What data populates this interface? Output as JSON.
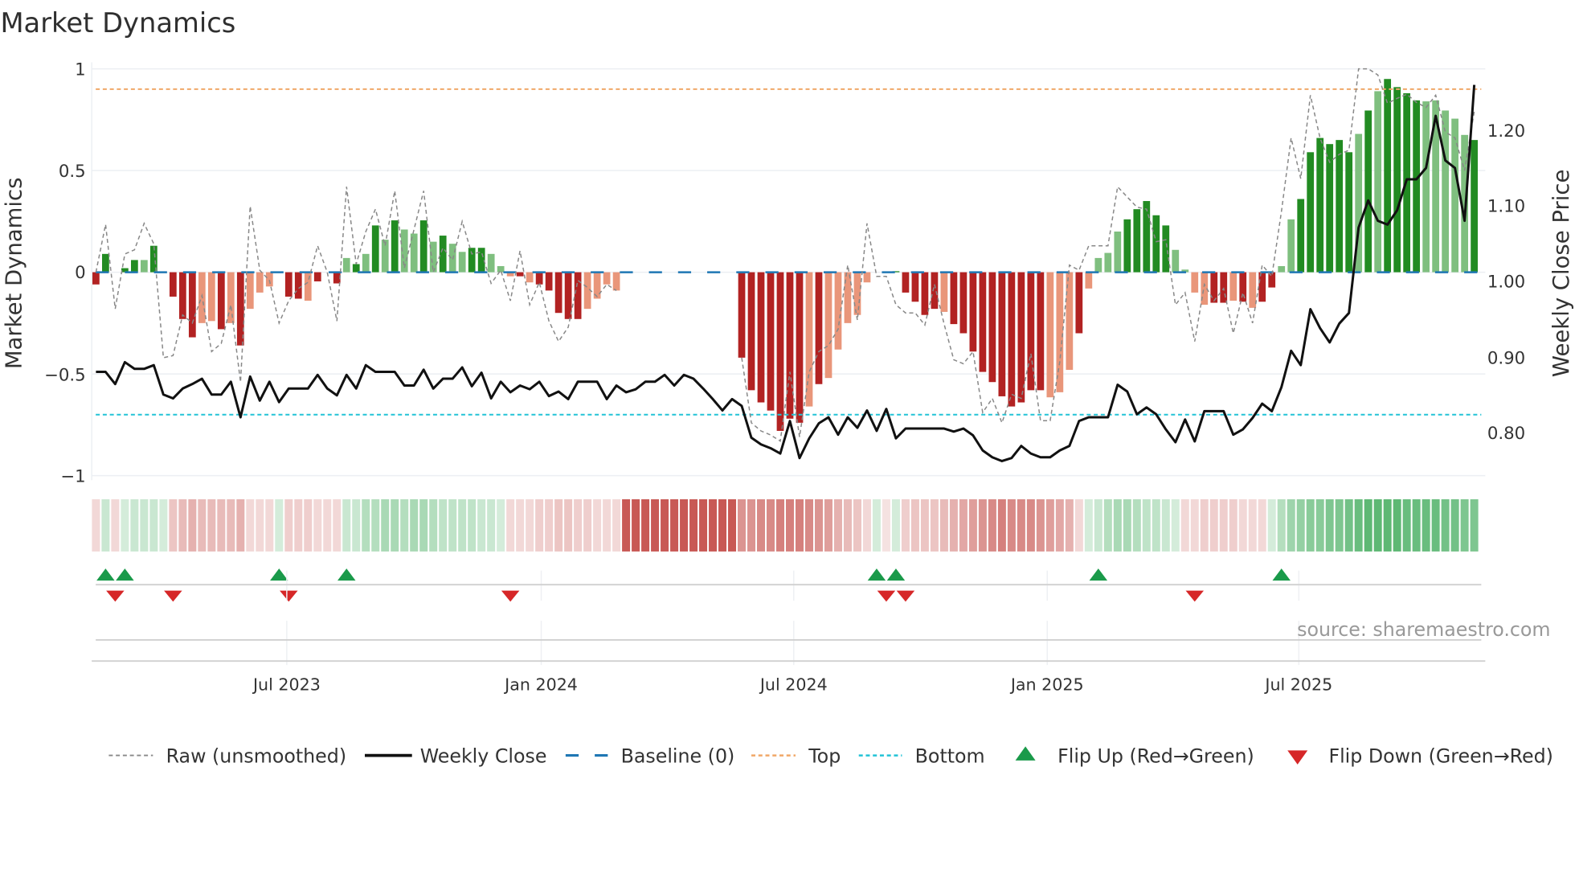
{
  "title": "Market Dynamics",
  "source": "source: sharemaestro.com",
  "colors": {
    "bar_green_strong": "#228b22",
    "bar_green_weak": "#7fbf7f",
    "bar_red_strong": "#b22222",
    "bar_red_weak": "#e9967a",
    "raw": "#888888",
    "close": "#111111",
    "baseline": "#1f77b4",
    "top": "#f0a868",
    "bottom": "#22c3d6",
    "flip_up": "#1a9a4a",
    "flip_down": "#d62728",
    "strip_green": [
      40,
      160,
      70
    ],
    "strip_red": [
      190,
      60,
      55
    ]
  },
  "chart_data": {
    "type": "bar",
    "title": "Market Dynamics",
    "ylabel": "Market Dynamics",
    "y2label": "Weekly Close Price",
    "ylim": [
      -1,
      1
    ],
    "y2lim": [
      0.7333,
      1.2666
    ],
    "yticks": [
      "1",
      "0.5",
      "0",
      "−0.5",
      "−1"
    ],
    "ytick_values": [
      1,
      0.5,
      0,
      -0.5,
      -1
    ],
    "y2ticks": [
      "1.20",
      "1.10",
      "1.00",
      "0.90",
      "0.80"
    ],
    "y2tick_values": [
      1.2,
      1.1,
      1.0,
      0.9,
      0.8
    ],
    "x_unit": "week index",
    "n_weeks": 144,
    "xticks": [
      "Jul 2023",
      "Jan 2024",
      "Jul 2024",
      "Jan 2025",
      "Jul 2025"
    ],
    "xtick_positions": [
      19.8,
      46.2,
      72.4,
      98.7,
      124.8
    ],
    "top_level": 0.9,
    "bottom_level": -0.7,
    "baseline": 0,
    "grid": true,
    "legend_position": "bottom",
    "series": [
      {
        "name": "Market Dynamics (bars)",
        "values": [
          -0.06,
          0.09,
          0,
          0.02,
          0.06,
          0.06,
          0.13,
          0,
          -0.12,
          -0.23,
          -0.32,
          -0.25,
          -0.24,
          -0.28,
          -0.25,
          -0.36,
          -0.18,
          -0.1,
          -0.07,
          0,
          -0.12,
          -0.13,
          -0.14,
          -0.045,
          0,
          -0.055,
          0.07,
          0.04,
          0.09,
          0.23,
          0.16,
          0.255,
          0.21,
          0.19,
          0.255,
          0.15,
          0.18,
          0.14,
          0.1,
          0.12,
          0.12,
          0.09,
          0.03,
          -0.02,
          -0.02,
          -0.05,
          -0.06,
          -0.09,
          -0.2,
          -0.23,
          -0.23,
          -0.18,
          -0.13,
          -0.06,
          -0.09,
          null,
          null,
          null,
          null,
          null,
          null,
          null,
          null,
          null,
          null,
          null,
          null,
          -0.42,
          -0.58,
          -0.64,
          -0.68,
          -0.78,
          -0.72,
          -0.74,
          -0.66,
          -0.55,
          -0.52,
          -0.38,
          -0.25,
          -0.21,
          -0.05,
          0,
          0,
          0.005,
          -0.1,
          -0.145,
          -0.21,
          -0.18,
          -0.195,
          -0.255,
          -0.3,
          -0.39,
          -0.49,
          -0.54,
          -0.61,
          -0.66,
          -0.64,
          -0.58,
          -0.58,
          -0.615,
          -0.59,
          -0.48,
          -0.3,
          -0.08,
          0.07,
          0.095,
          0.2,
          0.26,
          0.31,
          0.35,
          0.28,
          0.23,
          0.11,
          0.013,
          -0.1,
          -0.16,
          -0.15,
          -0.15,
          -0.14,
          -0.145,
          -0.175,
          -0.145,
          -0.075,
          0.03,
          0.26,
          0.36,
          0.59,
          0.66,
          0.63,
          0.65,
          0.59,
          0.68,
          0.795,
          0.89,
          0.95,
          0.91,
          0.88,
          0.845,
          0.84,
          0.845,
          0.795,
          0.755,
          0.675,
          0.65
        ],
        "strength": "dddddldddddlldldllldddldddldldldlldldllddllldldddddlllldddddddddddddddddddldllllllddddddlddddddddddllldlllldddddllllddldlddllddddddldlddddllllldllll"
      },
      {
        "name": "Raw (unsmoothed)",
        "values": [
          0.0,
          0.235,
          -0.18,
          0.09,
          0.11,
          0.24,
          0.14,
          -0.42,
          -0.41,
          -0.21,
          -0.25,
          -0.115,
          -0.39,
          -0.35,
          -0.16,
          -0.54,
          0.325,
          0.01,
          -0.04,
          -0.25,
          -0.14,
          -0.08,
          -0.05,
          0.13,
          0,
          -0.24,
          0.42,
          0.04,
          0.2,
          0.31,
          0.13,
          0.4,
          0.02,
          0.21,
          0.4,
          0,
          0.12,
          0.06,
          0.25,
          0.09,
          0.1,
          -0.055,
          0.01,
          -0.14,
          0.105,
          -0.16,
          -0.05,
          -0.24,
          -0.34,
          -0.27,
          -0.04,
          -0.075,
          -0.12,
          -0.06,
          -0.09,
          null,
          null,
          null,
          null,
          null,
          null,
          null,
          null,
          null,
          null,
          null,
          null,
          -0.42,
          -0.74,
          -0.78,
          -0.8,
          -0.83,
          -0.49,
          -0.81,
          -0.49,
          -0.39,
          -0.36,
          -0.28,
          0.035,
          -0.235,
          0.24,
          -0.02,
          -0.02,
          -0.16,
          -0.2,
          -0.2,
          -0.26,
          -0.06,
          -0.255,
          -0.43,
          -0.45,
          -0.39,
          -0.69,
          -0.62,
          -0.74,
          -0.6,
          -0.62,
          -0.4,
          -0.73,
          -0.73,
          -0.44,
          0.035,
          0.01,
          0.13,
          0.13,
          0.13,
          0.42,
          0.37,
          0.32,
          0.31,
          0.15,
          0.16,
          -0.16,
          -0.1,
          -0.34,
          -0.06,
          -0.14,
          -0.08,
          -0.3,
          -0.1,
          -0.25,
          0.035,
          -0.02,
          0.3,
          0.66,
          0.46,
          0.87,
          0.66,
          0.54,
          0.58,
          0.6,
          1.0,
          1.0,
          0.97,
          0.83,
          0.855,
          0.875,
          0.835,
          0.81,
          0.87,
          0.69,
          0.66,
          0.5,
          0.79
        ]
      },
      {
        "name": "Weekly Close",
        "axis": "right",
        "values": [
          0.88,
          0.88,
          0.864,
          0.893,
          0.884,
          0.884,
          0.889,
          0.85,
          0.845,
          0.858,
          0.864,
          0.871,
          0.85,
          0.85,
          0.867,
          0.82,
          0.874,
          0.842,
          0.867,
          0.84,
          0.858,
          0.858,
          0.858,
          0.876,
          0.858,
          0.849,
          0.876,
          0.858,
          0.889,
          0.88,
          0.88,
          0.88,
          0.862,
          0.862,
          0.883,
          0.858,
          0.871,
          0.871,
          0.886,
          0.861,
          0.879,
          0.845,
          0.867,
          0.853,
          0.862,
          0.857,
          0.867,
          0.848,
          0.854,
          0.844,
          0.867,
          0.867,
          0.867,
          0.844,
          0.862,
          0.853,
          0.857,
          0.867,
          0.867,
          0.876,
          0.862,
          0.876,
          0.871,
          0.858,
          0.844,
          0.829,
          0.844,
          0.835,
          0.793,
          0.784,
          0.779,
          0.772,
          0.815,
          0.766,
          0.792,
          0.812,
          0.82,
          0.797,
          0.82,
          0.806,
          0.829,
          0.802,
          0.831,
          0.792,
          0.805,
          0.805,
          0.805,
          0.805,
          0.805,
          0.801,
          0.805,
          0.796,
          0.776,
          0.767,
          0.762,
          0.766,
          0.782,
          0.772,
          0.767,
          0.767,
          0.776,
          0.782,
          0.815,
          0.82,
          0.82,
          0.82,
          0.863,
          0.854,
          0.824,
          0.833,
          0.824,
          0.804,
          0.787,
          0.817,
          0.788,
          0.828,
          0.828,
          0.828,
          0.797,
          0.804,
          0.819,
          0.838,
          0.828,
          0.86,
          0.908,
          0.889,
          0.963,
          0.938,
          0.919,
          0.944,
          0.958,
          1.071,
          1.107,
          1.08,
          1.075,
          1.094,
          1.135,
          1.135,
          1.15,
          1.219,
          1.16,
          1.15,
          1.08,
          1.26
        ]
      },
      {
        "name": "Regime strip",
        "values": [
          -0.2,
          0.25,
          -0.2,
          0.2,
          0.25,
          0.25,
          0.25,
          0.2,
          -0.3,
          -0.35,
          -0.4,
          -0.35,
          -0.35,
          -0.35,
          -0.35,
          -0.4,
          -0.2,
          -0.2,
          -0.2,
          0.2,
          -0.25,
          -0.25,
          -0.25,
          -0.2,
          -0.2,
          -0.2,
          0.25,
          0.25,
          0.35,
          0.35,
          0.4,
          0.4,
          0.35,
          0.4,
          0.4,
          0.35,
          0.3,
          0.3,
          0.3,
          0.3,
          0.25,
          0.25,
          0.2,
          -0.2,
          -0.2,
          -0.2,
          -0.25,
          -0.25,
          -0.3,
          -0.3,
          -0.25,
          -0.25,
          -0.2,
          -0.2,
          -0.2,
          -0.85,
          -0.85,
          -0.85,
          -0.85,
          -0.85,
          -0.85,
          -0.85,
          -0.85,
          -0.85,
          -0.85,
          -0.85,
          -0.85,
          -0.55,
          -0.55,
          -0.6,
          -0.6,
          -0.65,
          -0.65,
          -0.65,
          -0.6,
          -0.55,
          -0.5,
          -0.4,
          -0.35,
          -0.3,
          -0.2,
          0.2,
          -0.15,
          0.2,
          -0.25,
          -0.3,
          -0.3,
          -0.3,
          -0.35,
          -0.4,
          -0.45,
          -0.5,
          -0.55,
          -0.6,
          -0.65,
          -0.6,
          -0.6,
          -0.6,
          -0.55,
          -0.5,
          -0.45,
          -0.4,
          -0.2,
          0.2,
          0.25,
          0.35,
          0.4,
          0.4,
          0.35,
          0.3,
          0.3,
          0.25,
          0.2,
          -0.2,
          -0.2,
          -0.25,
          -0.25,
          -0.25,
          -0.25,
          -0.2,
          -0.2,
          -0.2,
          0.2,
          0.35,
          0.45,
          0.5,
          0.55,
          0.55,
          0.6,
          0.6,
          0.65,
          0.7,
          0.75,
          0.75,
          0.75,
          0.75,
          0.7,
          0.7,
          0.7,
          0.7,
          0.65,
          0.65,
          0.6,
          0.6
        ]
      }
    ],
    "flip_up_weeks": [
      1,
      3,
      19,
      26,
      81,
      83,
      104,
      123
    ],
    "flip_down_weeks": [
      2,
      8,
      20,
      43,
      82,
      84,
      114
    ],
    "legend": [
      "Raw (unsmoothed)",
      "Weekly Close",
      "Baseline (0)",
      "Top",
      "Bottom",
      "Flip Up (Red→Green)",
      "Flip Down (Green→Red)"
    ]
  }
}
